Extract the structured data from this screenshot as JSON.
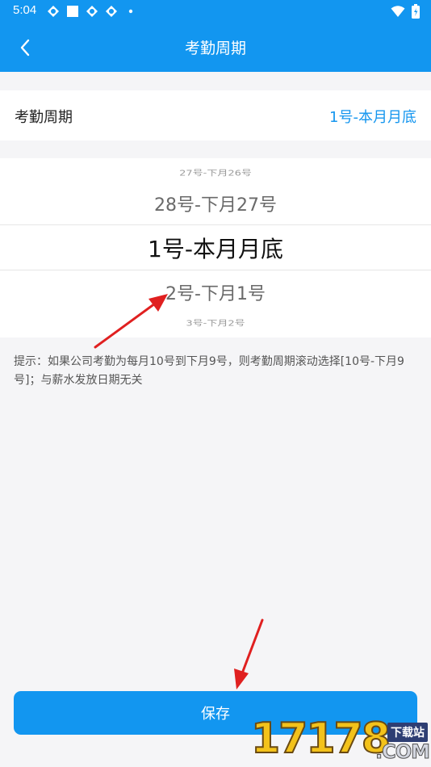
{
  "status_bar": {
    "time": "5:04",
    "icons": [
      "sync-icon",
      "square-icon",
      "sync-icon",
      "sync-icon",
      "dot-icon"
    ],
    "right_icons": [
      "wifi-icon",
      "battery-icon"
    ]
  },
  "header": {
    "title": "考勤周期",
    "back_icon": "chevron-left-icon",
    "background": "#1296f0"
  },
  "cycle_setting": {
    "label": "考勤周期",
    "value": "1号-本月月底",
    "value_color": "#1596ef"
  },
  "picker": {
    "items": [
      "27号-下月26号",
      "28号-下月27号",
      "1号-本月月底",
      "2号-下月1号",
      "3号-下月2号"
    ],
    "selected_index": 2
  },
  "hint": {
    "text": "提示：如果公司考勤为每月10号到下月9号，则考勤周期滚动选择[10号-下月9号]；与薪水发放日期无关"
  },
  "save_button": {
    "label": "保存",
    "color": "#1296f0"
  },
  "watermark": {
    "number": "17178",
    "tag": "下载站",
    "suffix": ".COM"
  },
  "annotations": {
    "arrow_color": "#e02020"
  }
}
